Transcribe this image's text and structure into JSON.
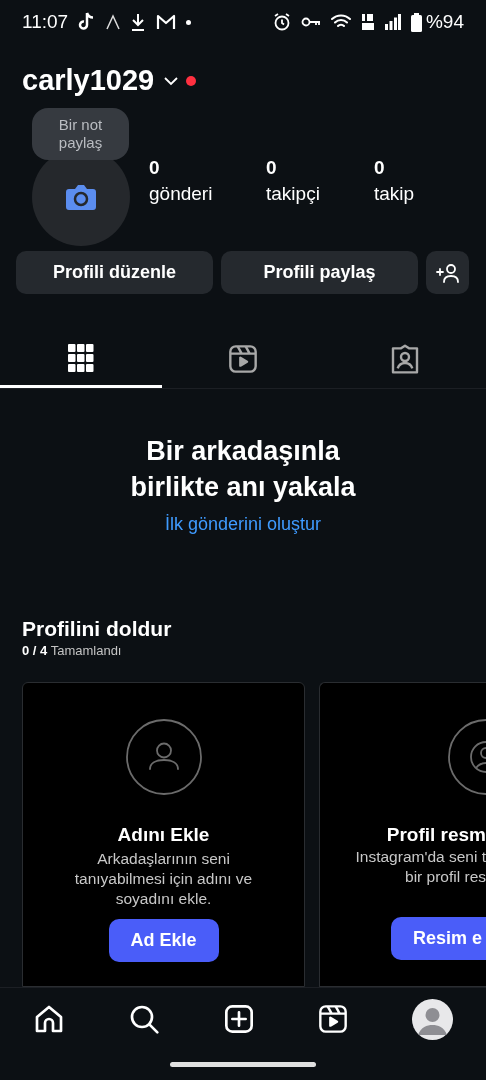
{
  "status_bar": {
    "time": "11:07",
    "battery": "%94"
  },
  "profile": {
    "username": "carly1029",
    "notification_dot": true,
    "note": "Bir not paylaş",
    "stats": [
      {
        "value": "0",
        "label": "gönderi"
      },
      {
        "value": "0",
        "label": "takipçi"
      },
      {
        "value": "0",
        "label": "takip"
      }
    ]
  },
  "buttons": [
    "Profili düzenle",
    "Profili paylaş"
  ],
  "tabs": [
    {
      "kind": "grid",
      "selected": true
    },
    {
      "kind": "reels",
      "selected": false
    },
    {
      "kind": "tagged",
      "selected": false
    }
  ],
  "empty_state": {
    "title": "Bir arkadaşınla birlikte anı yakala",
    "link": "İlk gönderini oluştur"
  },
  "complete_profile": {
    "title": "Profilini doldur",
    "progress": "**0 / 4** Tamamlandı",
    "cards": [
      {
        "kind": "name",
        "title": "Adını Ekle",
        "description": "Arkadaşlarının seni tanıyabilmesi için adını ve soyadını ekle.",
        "button": "Ad Ekle"
      },
      {
        "kind": "photo",
        "title": "Profil resm",
        "description_lines": [
          "Instagram'da seni t",
          "bir profil res"
        ],
        "button": "Resim e"
      }
    ]
  },
  "nav": [
    {
      "kind": "home"
    },
    {
      "kind": "search"
    },
    {
      "kind": "create"
    },
    {
      "kind": "reels"
    },
    {
      "kind": "profile"
    }
  ]
}
